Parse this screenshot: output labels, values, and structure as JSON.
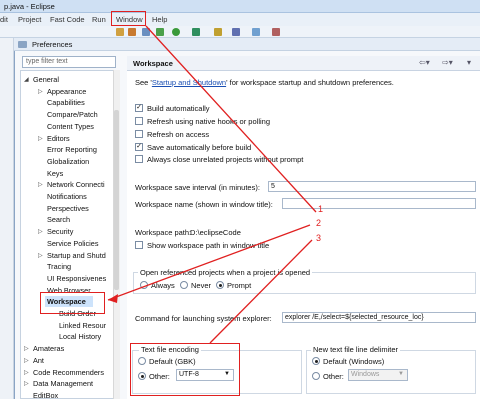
{
  "window": {
    "title": "p.java - Eclipse"
  },
  "menu": [
    "dit",
    "Project",
    "Fast Code",
    "Run",
    "Window",
    "Help"
  ],
  "dialog": {
    "title": "Preferences"
  },
  "filter": {
    "placeholder": "type filter text"
  },
  "tree": [
    {
      "label": "General",
      "level": 0,
      "expanded": true
    },
    {
      "label": "Appearance",
      "level": 1,
      "arrow": true
    },
    {
      "label": "Capabilities",
      "level": 1
    },
    {
      "label": "Compare/Patch",
      "level": 1
    },
    {
      "label": "Content Types",
      "level": 1
    },
    {
      "label": "Editors",
      "level": 1,
      "arrow": true
    },
    {
      "label": "Error Reporting",
      "level": 1
    },
    {
      "label": "Globalization",
      "level": 1
    },
    {
      "label": "Keys",
      "level": 1
    },
    {
      "label": "Network Connecti",
      "level": 1,
      "arrow": true
    },
    {
      "label": "Notifications",
      "level": 1
    },
    {
      "label": "Perspectives",
      "level": 1
    },
    {
      "label": "Search",
      "level": 1
    },
    {
      "label": "Security",
      "level": 1,
      "arrow": true
    },
    {
      "label": "Service Policies",
      "level": 1
    },
    {
      "label": "Startup and Shutd",
      "level": 1,
      "arrow": true
    },
    {
      "label": "Tracing",
      "level": 1
    },
    {
      "label": "UI Responsivenes",
      "level": 1
    },
    {
      "label": "Web Browser",
      "level": 1
    },
    {
      "label": "Workspace",
      "level": 1,
      "selected": true
    },
    {
      "label": "Build Order",
      "level": 2
    },
    {
      "label": "Linked Resour",
      "level": 2
    },
    {
      "label": "Local History",
      "level": 2
    },
    {
      "label": "Amateras",
      "level": 0,
      "arrow": true
    },
    {
      "label": "Ant",
      "level": 0,
      "arrow": true
    },
    {
      "label": "Code Recommenders",
      "level": 0,
      "arrow": true
    },
    {
      "label": "Data Management",
      "level": 0,
      "arrow": true
    },
    {
      "label": "EditBox",
      "level": 0
    }
  ],
  "panel": {
    "title": "Workspace",
    "see_prefix": "See '",
    "see_link": "Startup and Shutdown",
    "see_suffix": "' for workspace startup and shutdown preferences.",
    "checks": [
      {
        "label": "Build automatically",
        "checked": true
      },
      {
        "label": "Refresh using native hooks or polling",
        "checked": false
      },
      {
        "label": "Refresh on access",
        "checked": false
      },
      {
        "label": "Save automatically before build",
        "checked": true
      },
      {
        "label": "Always close unrelated projects without prompt",
        "checked": false
      }
    ],
    "save_interval_label": "Workspace save interval (in minutes):",
    "save_interval_value": "5",
    "workspace_name_label": "Workspace name (shown in window title):",
    "workspace_name_value": "",
    "workspace_path_label": "Workspace path:",
    "workspace_path_value": "D:\\eclipseCode",
    "show_path_label": "Show workspace path in window title",
    "open_ref_label": "Open referenced projects when a project is opened",
    "open_ref_options": [
      "Always",
      "Never",
      "Prompt"
    ],
    "open_ref_selected": "Prompt",
    "sys_explorer_label": "Command for launching system explorer:",
    "sys_explorer_value": "explorer /E,/select=${selected_resource_loc}",
    "encoding_title": "Text file encoding",
    "encoding_default": "Default (GBK)",
    "encoding_other": "Other:",
    "encoding_value": "UTF-8",
    "delimiter_title": "New text file line delimiter",
    "delimiter_default": "Default (Windows)",
    "delimiter_other": "Other:",
    "delimiter_value": "Windows"
  },
  "annotations": [
    "1",
    "2",
    "3"
  ],
  "colors": {
    "annotation": "#e02020",
    "selection": "#cde3fb"
  }
}
